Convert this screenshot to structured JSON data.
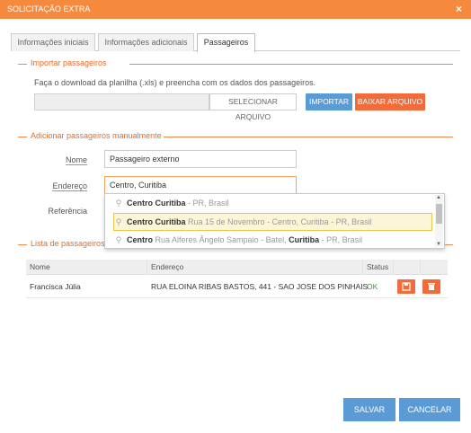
{
  "window": {
    "title": "SOLICITAÇÃO EXTRA",
    "close_glyph": "×"
  },
  "tabs": [
    {
      "label": "Informações iniciais",
      "active": false
    },
    {
      "label": "Informações adicionais",
      "active": false
    },
    {
      "label": "Passageiros",
      "active": true
    }
  ],
  "import_section": {
    "title": "Importar passageiros",
    "instructions": "Faça o download da planilha (.xls) e preencha com os dados dos passageiros.",
    "file_value": "",
    "select_button": "SELECIONAR ARQUIVO",
    "import_button": "IMPORTAR",
    "download_button": "BAIXAR ARQUIVO"
  },
  "manual_section": {
    "title": "Adicionar passageiros manualmente",
    "name_label": "Nome",
    "name_value": "Passageiro externo",
    "address_label": "Endereço",
    "address_value": "Centro, Curitiba",
    "reference_label": "Referência"
  },
  "autocomplete": {
    "items": [
      {
        "bold": "Centro",
        "bold2": "Curitiba",
        "rest": " - PR, Brasil",
        "selected": false
      },
      {
        "bold": "Centro Curitiba",
        "rest": " Rua 15 de Novembro - Centro, Curitiba - PR, Brasil",
        "selected": true
      },
      {
        "bold": "Centro",
        "mid": " Rua Alferes Ângelo Sampaio - Batel, ",
        "bold2": "Curitiba",
        "rest": " - PR, Brasil",
        "selected": false
      }
    ]
  },
  "list_section": {
    "title": "Lista de passageiros",
    "columns": [
      "Nome",
      "Endereço",
      "Status"
    ],
    "rows": [
      {
        "name": "Francisca Júlia",
        "address": "RUA ELOINA RIBAS BASTOS, 441 - SAO JOSE DOS PINHAIS",
        "status": "OK"
      }
    ]
  },
  "footer": {
    "save": "SALVAR",
    "cancel": "CANCELAR"
  },
  "colors": {
    "accent": "#f58a3f",
    "primary": "#5b9bd5",
    "danger": "#f26b3a",
    "ok": "#3c9a3c"
  }
}
